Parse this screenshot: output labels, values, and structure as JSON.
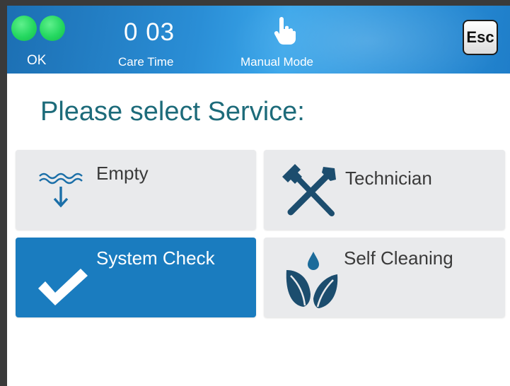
{
  "status": {
    "ok_label": "OK",
    "care_time_value": "0 03",
    "care_time_label": "Care Time",
    "mode_label": "Manual Mode",
    "esc_label": "Esc"
  },
  "main": {
    "title": "Please select Service:"
  },
  "services": [
    {
      "label": "Empty",
      "icon": "drain-water-icon",
      "selected": false
    },
    {
      "label": "Technician",
      "icon": "tools-icon",
      "selected": false
    },
    {
      "label": "System Check",
      "icon": "checkmark-icon",
      "selected": true
    },
    {
      "label": "Self Cleaning",
      "icon": "leaf-drop-icon",
      "selected": false
    }
  ],
  "colors": {
    "header": "#2a8ed6",
    "selected_tile": "#1a7cbf",
    "tile": "#e9eaec",
    "title_text": "#1d6b7a",
    "status_led": "#24d860"
  }
}
